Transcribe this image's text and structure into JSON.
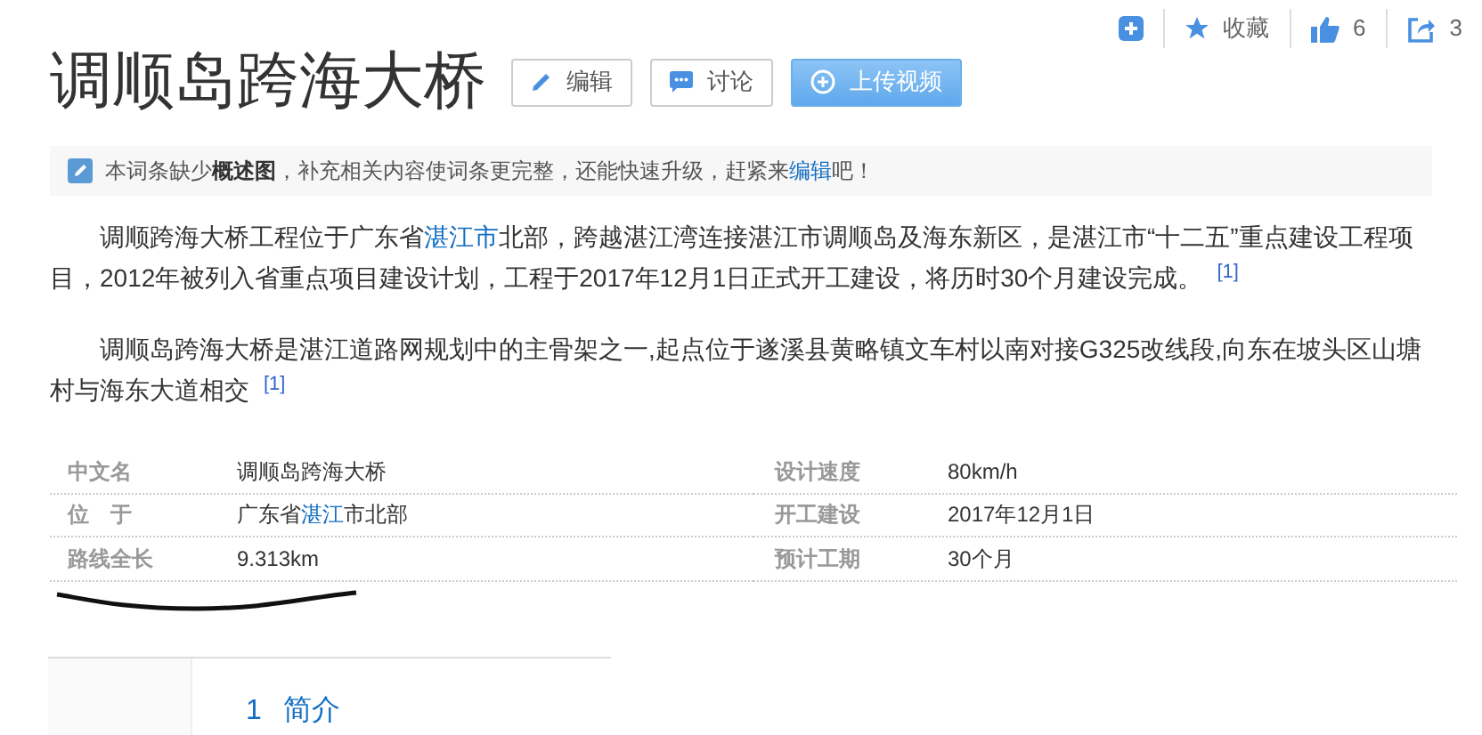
{
  "toolbar": [
    {
      "kind": "add"
    },
    {
      "kind": "star",
      "label": "收藏"
    },
    {
      "kind": "like",
      "label": "6"
    },
    {
      "kind": "share",
      "label": "3"
    }
  ],
  "title": "调顺岛跨海大桥",
  "title_buttons": [
    {
      "kind": "edit",
      "label": "编辑"
    },
    {
      "kind": "discuss",
      "label": "讨论"
    },
    {
      "kind": "upload",
      "label": "上传视频"
    }
  ],
  "notice": [
    {
      "kind": "text",
      "text": "本词条缺少**概述图**，补充相关内容使词条更完整，还能快速升级，赶紧来"
    },
    {
      "kind": "link",
      "text": "编辑"
    },
    {
      "kind": "text",
      "text": "吧！"
    }
  ],
  "paragraphs": [
    [
      {
        "kind": "text",
        "text": "调顺跨海大桥工程位于广东省"
      },
      {
        "kind": "link",
        "text": "湛江市"
      },
      {
        "kind": "text",
        "text": "北部，跨越湛江湾连接湛江市调顺岛及海东新区，是湛江市“十二五”重点建设工程项目，2012年被列入省重点项目建设计划，工程于2017年12月1日正式开工建设，将历时30个月建设完成。"
      },
      {
        "kind": "ref",
        "text": "[1]"
      }
    ],
    [
      {
        "kind": "text",
        "text": "调顺岛跨海大桥是湛江道路网规划中的主骨架之一,起点位于遂溪县黄略镇文车村以南对接G325改线段,向东在坡头区山塘村与海东大道相交"
      },
      {
        "kind": "ref",
        "text": "[1]"
      }
    ]
  ],
  "info": [
    [
      {
        "label": "中文名",
        "value": [
          {
            "kind": "text",
            "text": "调顺岛跨海大桥"
          }
        ]
      },
      {
        "label": "设计速度",
        "value": [
          {
            "kind": "text",
            "text": "80km/h"
          }
        ]
      }
    ],
    [
      {
        "label": "位　于",
        "value": [
          {
            "kind": "text",
            "text": "广东省"
          },
          {
            "kind": "link",
            "text": "湛江"
          },
          {
            "kind": "text",
            "text": "市北部"
          }
        ]
      },
      {
        "label": "开工建设",
        "value": [
          {
            "kind": "text",
            "text": "2017年12月1日"
          }
        ]
      }
    ],
    [
      {
        "label": "路线全长",
        "value": [
          {
            "kind": "text",
            "text": "9.313km"
          }
        ]
      },
      {
        "label": "预计工期",
        "value": [
          {
            "kind": "text",
            "text": "30个月"
          }
        ]
      }
    ]
  ],
  "catalog": [
    {
      "number": "1",
      "label": "简介"
    }
  ]
}
